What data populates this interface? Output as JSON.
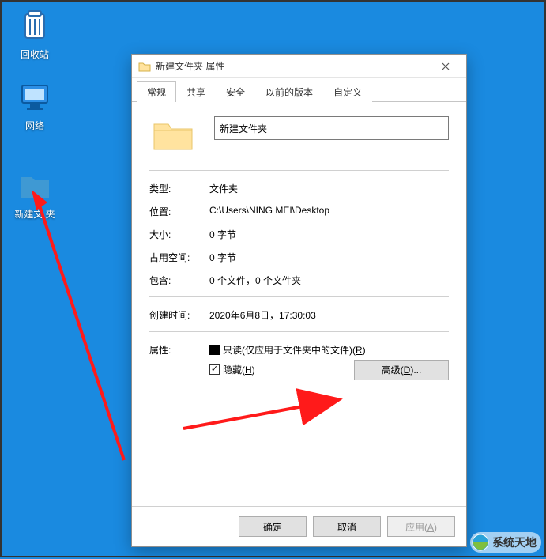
{
  "desktop": {
    "recycle_bin": "回收站",
    "network": "网络",
    "new_folder": "新建文   夹"
  },
  "dialog": {
    "title": "新建文件夹 属性",
    "tabs": {
      "general": "常规",
      "sharing": "共享",
      "security": "安全",
      "previous": "以前的版本",
      "customize": "自定义"
    },
    "folder_name": "新建文件夹",
    "fields": {
      "type_label": "类型:",
      "type_value": "文件夹",
      "location_label": "位置:",
      "location_value": "C:\\Users\\NING MEI\\Desktop",
      "size_label": "大小:",
      "size_value": "0 字节",
      "size_on_disk_label": "占用空间:",
      "size_on_disk_value": "0 字节",
      "contains_label": "包含:",
      "contains_value": "0 个文件，0 个文件夹",
      "created_label": "创建时间:",
      "created_value": "2020年6月8日，17:30:03",
      "attributes_label": "属性:"
    },
    "checkboxes": {
      "readonly_prefix": "只读(仅应用于文件夹中的文件)(",
      "readonly_accel": "R",
      "readonly_suffix": ")",
      "hidden_prefix": "隐藏(",
      "hidden_accel": "H",
      "hidden_suffix": ")"
    },
    "buttons": {
      "advanced_prefix": "高级(",
      "advanced_accel": "D",
      "advanced_suffix": ")...",
      "ok": "确定",
      "cancel": "取消",
      "apply_prefix": "应用(",
      "apply_accel": "A",
      "apply_suffix": ")"
    }
  },
  "watermark": "系统天地"
}
